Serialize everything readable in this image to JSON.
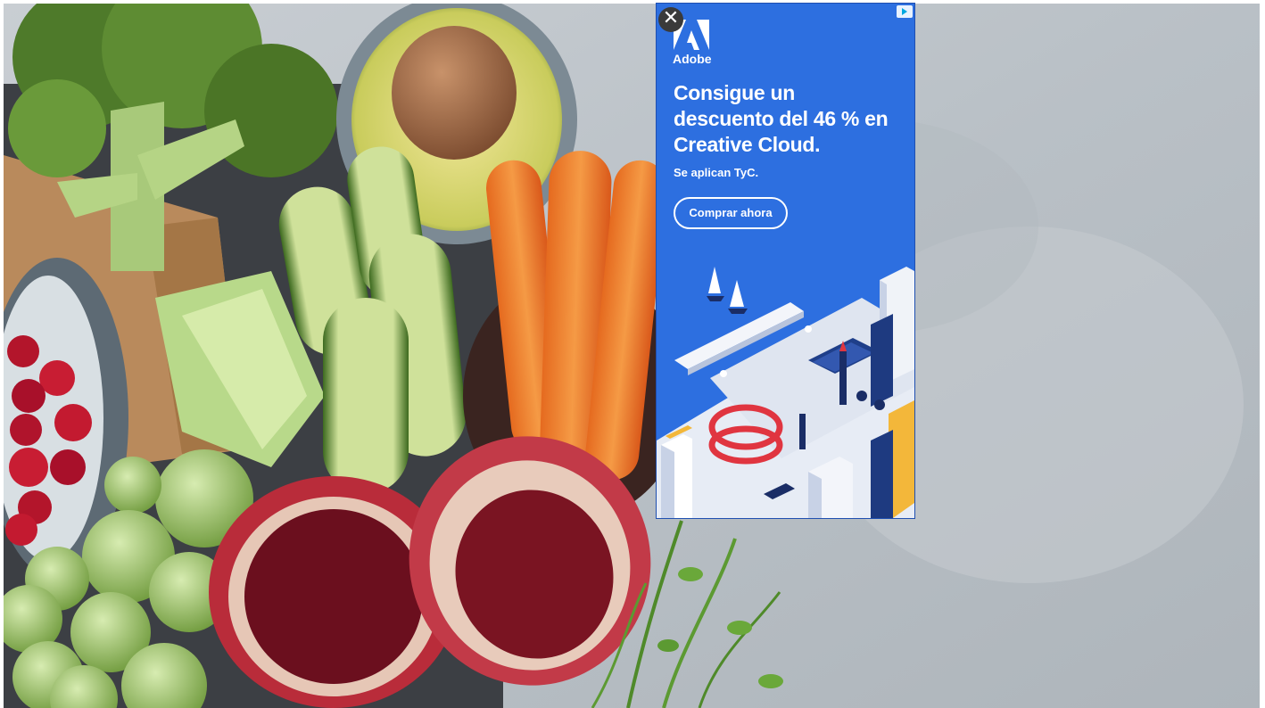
{
  "ad": {
    "brand": "Adobe",
    "headline": "Consigue un descuento del 46 % en Creative Cloud.",
    "terms": "Se aplican TyC.",
    "cta_label": "Comprar ahora",
    "close_symbol": "✕",
    "icons": [
      "close-icon",
      "adchoices-icon",
      "adobe-logo-icon"
    ],
    "colors": {
      "background": "#2d6fe0",
      "text": "#ffffff"
    }
  }
}
